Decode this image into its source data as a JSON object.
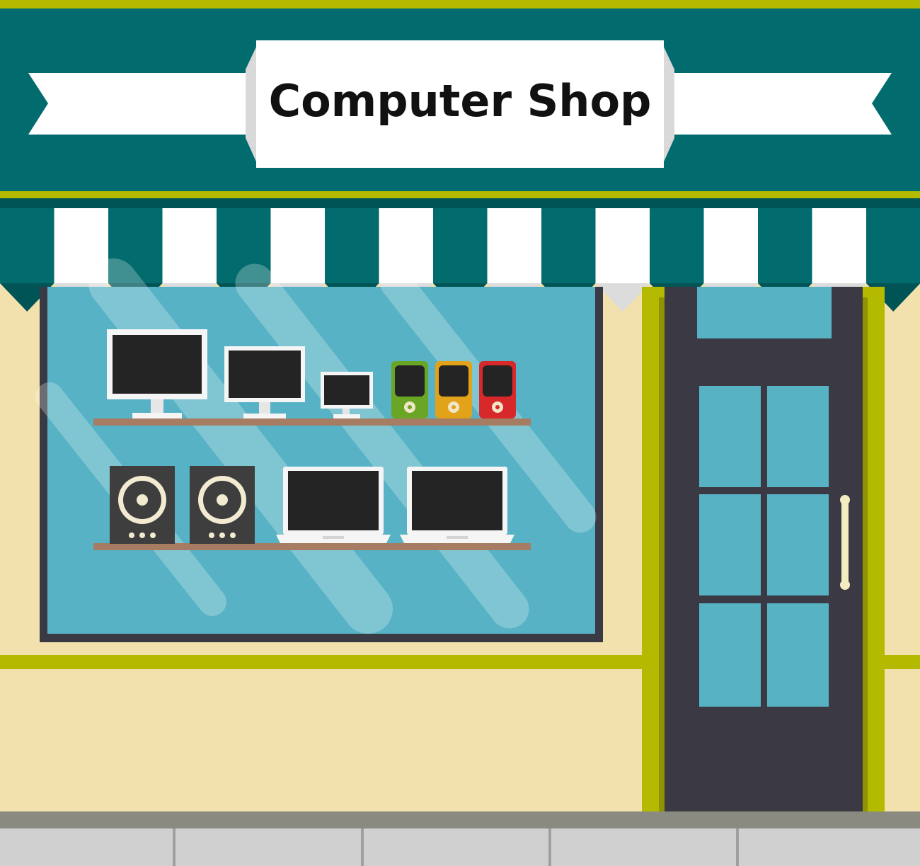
{
  "sign": {
    "title": "Computer Shop"
  },
  "colors": {
    "wall": "#f2e1ad",
    "teal": "#016b6d",
    "lime": "#b4ba00",
    "awning_white": "#ffffff",
    "awning_shade": "#dcdcdc",
    "window_glass": "#56b2c4",
    "window_frame": "#3a3a44",
    "door": "#3b3943",
    "door_glass": "#57b3c4",
    "shelf": "#a67c62",
    "sidewalk": "#d0d0d0",
    "curb": "#8a8a80",
    "screen": "#242424",
    "device_white": "#f5f5f5",
    "speaker": "#3e3e3e",
    "player_green": "#6aa626",
    "player_orange": "#e2a21a",
    "player_red": "#d7282a",
    "handle": "#f3ecc0"
  },
  "display": {
    "top_shelf_items": [
      "monitor-large",
      "monitor-medium",
      "monitor-small",
      "media-player-green",
      "media-player-orange",
      "media-player-red"
    ],
    "bottom_shelf_items": [
      "speaker-left",
      "speaker-right",
      "laptop-left",
      "laptop-right"
    ]
  }
}
